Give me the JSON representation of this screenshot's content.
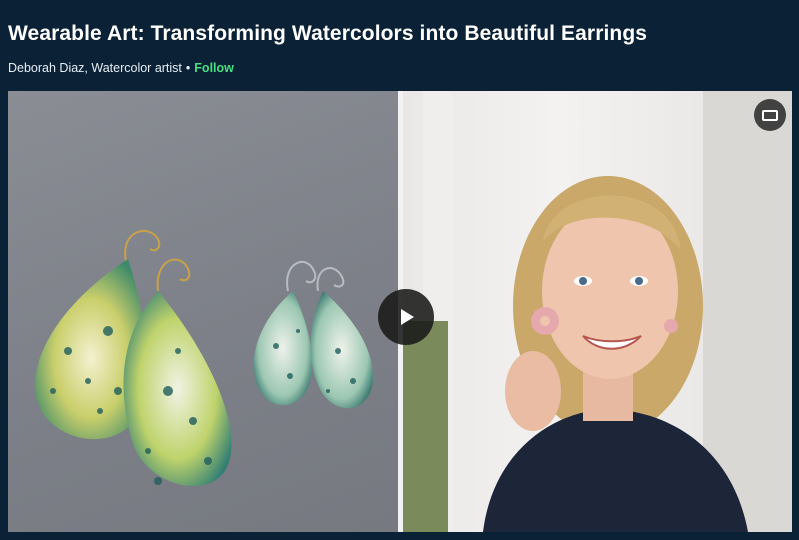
{
  "course": {
    "title": "Wearable Art: Transforming Watercolors into Beautiful Earrings",
    "instructor": "Deborah Diaz, Watercolor artist",
    "separator": "•",
    "follow_label": "Follow"
  },
  "video": {
    "play_icon": "play-icon",
    "screen_icon": "screen-mode-icon"
  },
  "colors": {
    "background": "#0b2236",
    "follow": "#4ade80"
  }
}
